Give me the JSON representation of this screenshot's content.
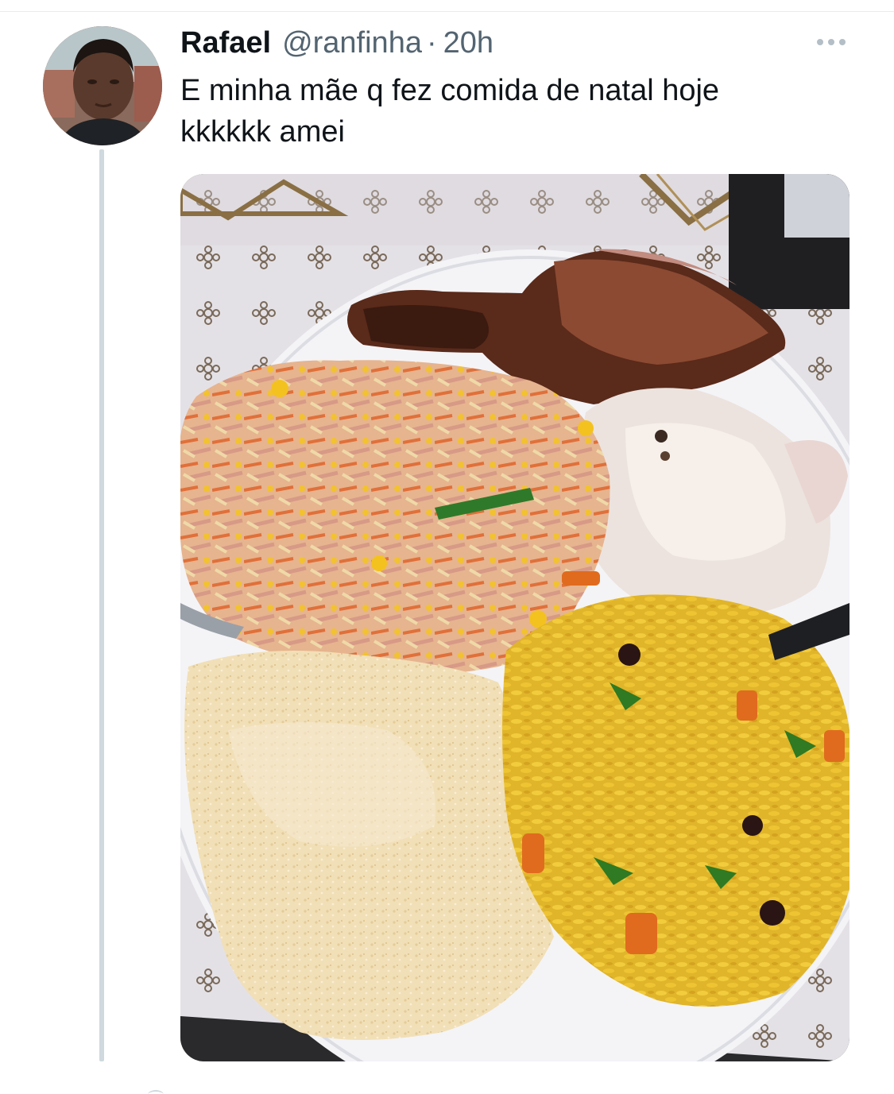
{
  "tweet": {
    "display_name": "Rafael",
    "handle": "@ranfinha",
    "separator": "·",
    "time": "20h",
    "text_lines": [
      "E minha mãe q fez comida de natal hoje",
      "kkkkkk amei"
    ],
    "avatar": "user-avatar-photo",
    "more_icon": "more-horizontal-icon",
    "media": "photo-christmas-dinner-plate"
  },
  "colors": {
    "text_primary": "#0f1419",
    "text_secondary": "#536471",
    "thread_line": "#cfd9de",
    "divider": "#e6ecf0"
  }
}
